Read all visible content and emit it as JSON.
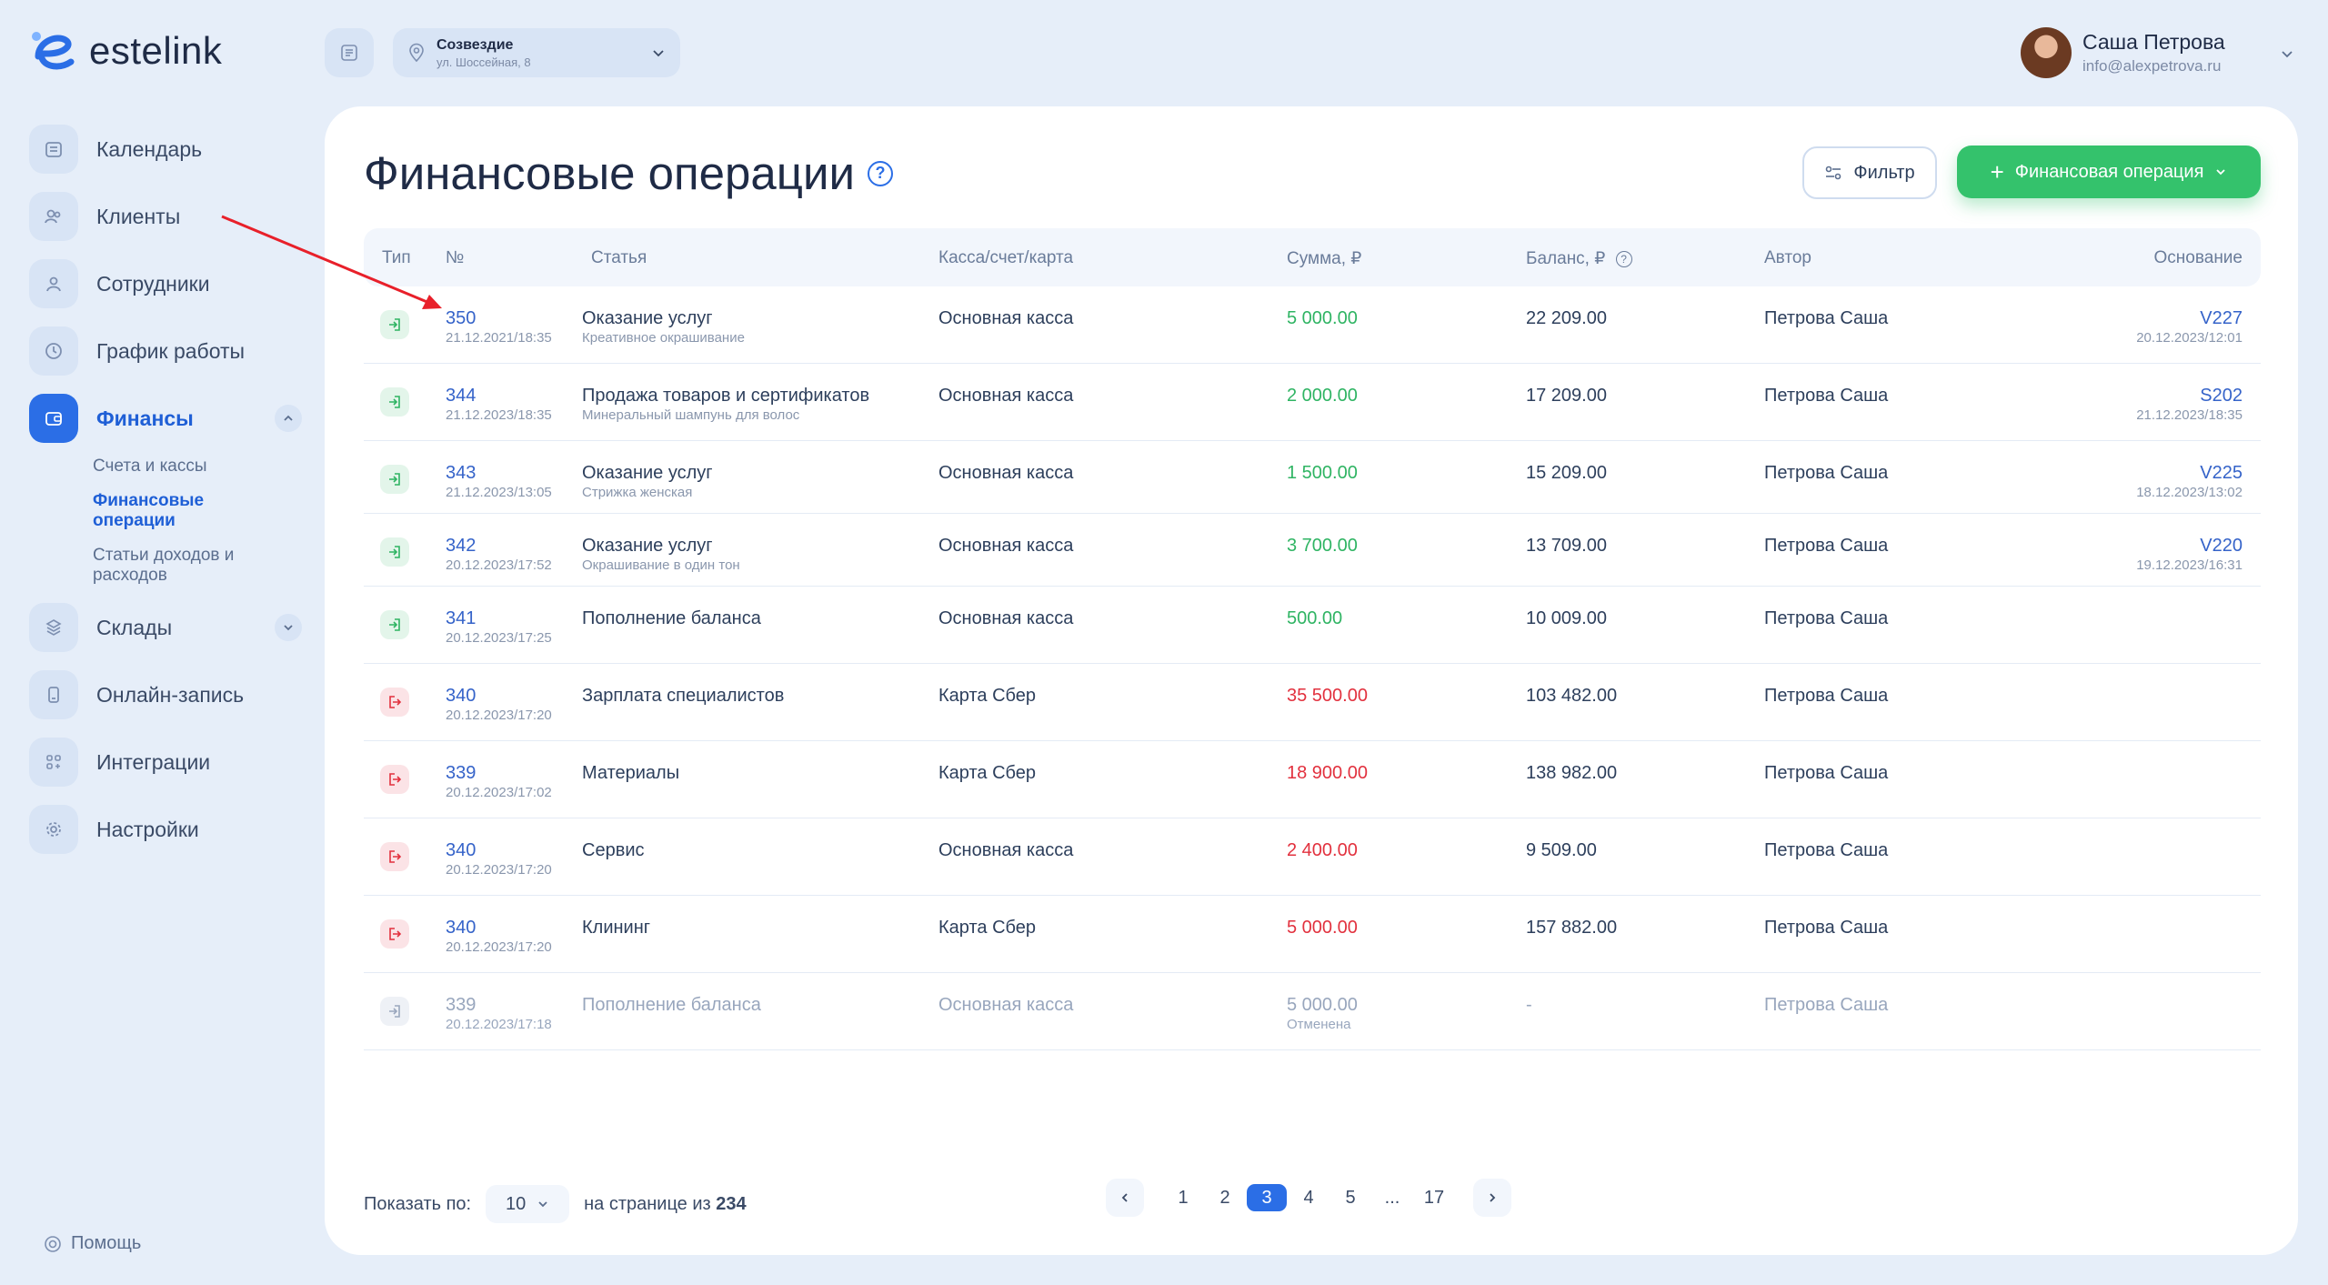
{
  "brand": {
    "name": "estelink"
  },
  "sidebar": {
    "items": [
      {
        "label": "Календарь",
        "icon": "calendar-icon"
      },
      {
        "label": "Клиенты",
        "icon": "clients-icon"
      },
      {
        "label": "Сотрудники",
        "icon": "staff-icon"
      },
      {
        "label": "График работы",
        "icon": "clock-icon"
      },
      {
        "label": "Финансы",
        "icon": "wallet-icon",
        "active": true
      },
      {
        "label": "Склады",
        "icon": "warehouse-icon"
      },
      {
        "label": "Онлайн-запись",
        "icon": "phone-icon"
      },
      {
        "label": "Интеграции",
        "icon": "integrations-icon"
      },
      {
        "label": "Настройки",
        "icon": "gear-icon"
      }
    ],
    "finance_sub": [
      {
        "label": "Счета и кассы"
      },
      {
        "label": "Финансовые операции",
        "active": true
      },
      {
        "label": "Статьи доходов и расходов"
      }
    ],
    "help": "Помощь"
  },
  "topbar": {
    "branch_name": "Созвездие",
    "branch_address": "ул. Шоссейная, 8",
    "user_name": "Саша Петрова",
    "user_email": "info@alexpetrova.ru"
  },
  "page": {
    "title": "Финансовые операции",
    "filter_label": "Фильтр",
    "add_label": "Финансовая операция"
  },
  "table": {
    "headers": {
      "type": "Тип",
      "number": "№",
      "article": "Статья",
      "account": "Касса/счет/карта",
      "amount": "Сумма, ₽",
      "balance": "Баланс, ₽",
      "author": "Автор",
      "basis": "Основание"
    },
    "rows": [
      {
        "kind": "in",
        "number": "350",
        "date": "21.12.2021/18:35",
        "article": "Оказание услуг",
        "article_sub": "Креативное окрашивание",
        "account": "Основная касса",
        "amount": "5 000.00",
        "amount_sub": "",
        "balance": "22 209.00",
        "author": "Петрова Саша",
        "basis": "V227",
        "basis_date": "20.12.2023/12:01"
      },
      {
        "kind": "in",
        "number": "344",
        "date": "21.12.2023/18:35",
        "article": "Продажа товаров и сертификатов",
        "article_sub": "Минеральный шампунь для волос",
        "account": "Основная касса",
        "amount": "2 000.00",
        "amount_sub": "",
        "balance": "17 209.00",
        "author": "Петрова Саша",
        "basis": "S202",
        "basis_date": "21.12.2023/18:35"
      },
      {
        "kind": "in",
        "number": "343",
        "date": "21.12.2023/13:05",
        "article": "Оказание услуг",
        "article_sub": "Стрижка женская",
        "account": "Основная касса",
        "amount": "1 500.00",
        "amount_sub": "",
        "balance": "15 209.00",
        "author": "Петрова Саша",
        "basis": "V225",
        "basis_date": "18.12.2023/13:02"
      },
      {
        "kind": "in",
        "number": "342",
        "date": "20.12.2023/17:52",
        "article": "Оказание услуг",
        "article_sub": "Окрашивание в один тон",
        "account": "Основная касса",
        "amount": "3 700.00",
        "amount_sub": "",
        "balance": "13 709.00",
        "author": "Петрова Саша",
        "basis": "V220",
        "basis_date": "19.12.2023/16:31"
      },
      {
        "kind": "in",
        "number": "341",
        "date": "20.12.2023/17:25",
        "article": "Пополнение баланса",
        "article_sub": "",
        "account": "Основная касса",
        "amount": "500.00",
        "amount_sub": "",
        "balance": "10 009.00",
        "author": "Петрова Саша",
        "basis": "",
        "basis_date": ""
      },
      {
        "kind": "out",
        "number": "340",
        "date": "20.12.2023/17:20",
        "article": "Зарплата специалистов",
        "article_sub": "",
        "account": "Карта Сбер",
        "amount": "35 500.00",
        "amount_sub": "",
        "balance": "103 482.00",
        "author": "Петрова Саша",
        "basis": "",
        "basis_date": ""
      },
      {
        "kind": "out",
        "number": "339",
        "date": "20.12.2023/17:02",
        "article": "Материалы",
        "article_sub": "",
        "account": "Карта Сбер",
        "amount": "18 900.00",
        "amount_sub": "",
        "balance": "138 982.00",
        "author": "Петрова Саша",
        "basis": "",
        "basis_date": ""
      },
      {
        "kind": "out",
        "number": "340",
        "date": "20.12.2023/17:20",
        "article": "Сервис",
        "article_sub": "",
        "account": "Основная касса",
        "amount": "2 400.00",
        "amount_sub": "",
        "balance": "9 509.00",
        "author": "Петрова Саша",
        "basis": "",
        "basis_date": ""
      },
      {
        "kind": "out",
        "number": "340",
        "date": "20.12.2023/17:20",
        "article": "Клининг",
        "article_sub": "",
        "account": "Карта Сбер",
        "amount": "5 000.00",
        "amount_sub": "",
        "balance": "157 882.00",
        "author": "Петрова Саша",
        "basis": "",
        "basis_date": ""
      },
      {
        "kind": "cancelled",
        "number": "339",
        "date": "20.12.2023/17:18",
        "article": "Пополнение баланса",
        "article_sub": "",
        "account": "Основная касса",
        "amount": "5 000.00",
        "amount_sub": "Отменена",
        "balance": "-",
        "author": "Петрова Саша",
        "basis": "",
        "basis_date": ""
      }
    ]
  },
  "pagination": {
    "show_label": "Показать по:",
    "per_page": "10",
    "of_label": "на странице из",
    "total": "234",
    "pages": [
      "1",
      "2",
      "3",
      "4",
      "5",
      "...",
      "17"
    ],
    "current": "3"
  },
  "colors": {
    "accent": "#2b6ee6",
    "income": "#2fb463",
    "expense": "#e2313e",
    "add_button": "#34c26c",
    "annotation_arrow": "#e8202a"
  }
}
